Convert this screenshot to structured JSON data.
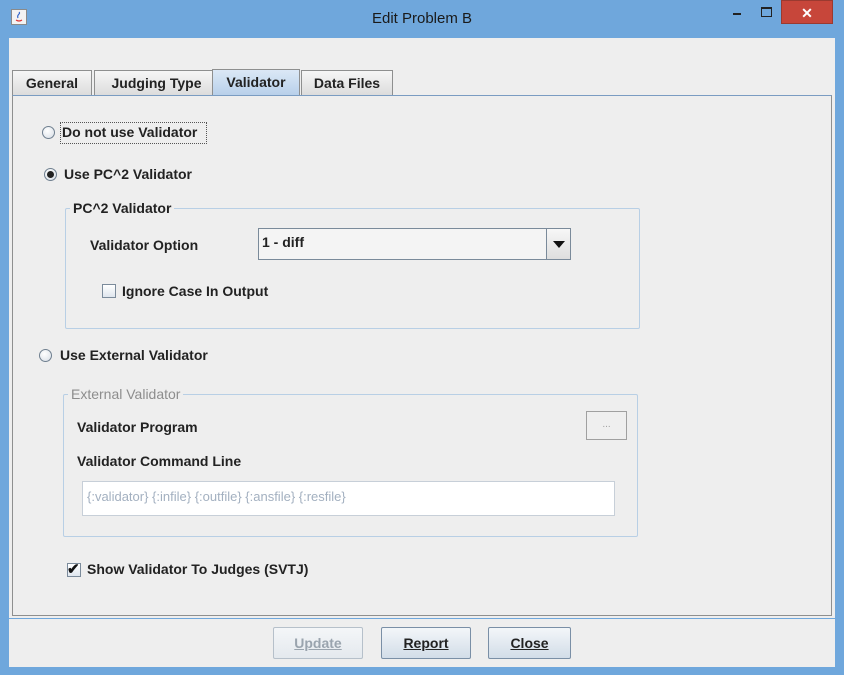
{
  "window": {
    "title": "Edit Problem B",
    "min_symbol": "",
    "max_symbol": "",
    "close_symbol": "✕"
  },
  "tabs": [
    {
      "label": "General"
    },
    {
      "label": "Judging Type"
    },
    {
      "label": "Validator",
      "selected": true
    },
    {
      "label": "Data Files"
    }
  ],
  "validator": {
    "no_validator_label": "Do not use Validator",
    "use_pc2_label": "Use PC^2 Validator",
    "selected_option": "use_pc2",
    "pc2_group": {
      "title": "PC^2 Validator",
      "option_label": "Validator Option",
      "option_value": "1 - diff",
      "ignore_case_label": "Ignore Case In Output",
      "ignore_case_checked": false
    },
    "use_external_label": "Use External Validator",
    "external_group": {
      "title": "External Validator",
      "program_label": "Validator Program",
      "browse_label": "...",
      "command_line_label": "Validator Command Line",
      "command_line_value": "{:validator} {:infile} {:outfile} {:ansfile} {:resfile}"
    },
    "show_to_judges_label": "Show Validator To Judges (SVTJ)",
    "show_to_judges_checked": true
  },
  "buttons": {
    "update": "Update",
    "report": "Report",
    "close": "Close"
  },
  "colors": {
    "titlebar": "#6fa7dc",
    "close_button": "#c7463a",
    "panel": "#eeeeee"
  }
}
